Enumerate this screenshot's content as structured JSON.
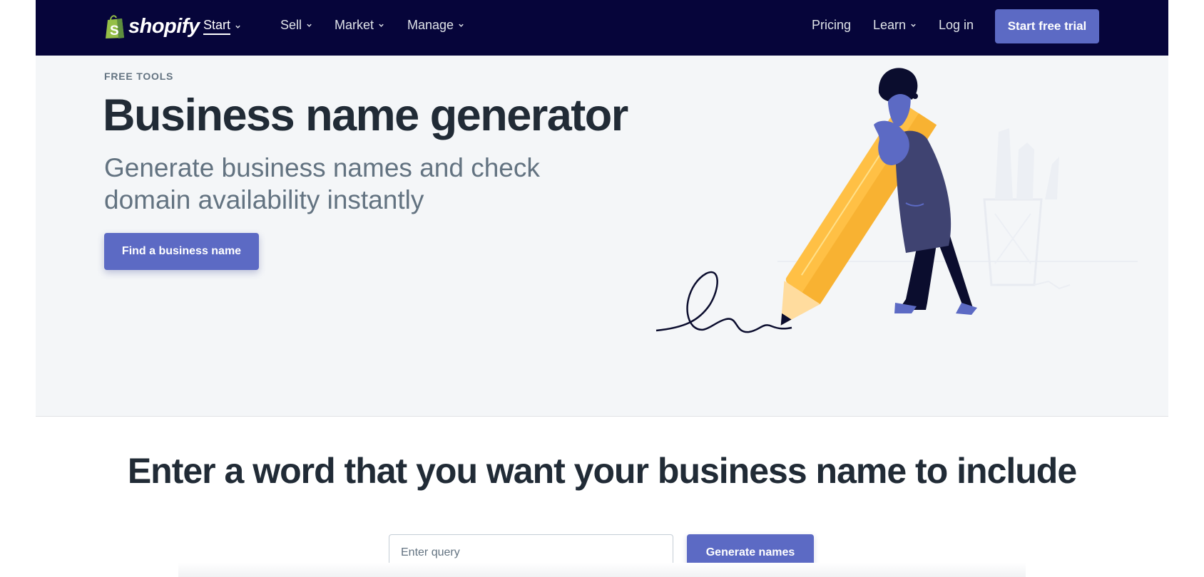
{
  "nav": {
    "brand": "shopify",
    "left_items": [
      {
        "label": "Start",
        "has_dropdown": true,
        "active": true
      },
      {
        "label": "Sell",
        "has_dropdown": true,
        "active": false
      },
      {
        "label": "Market",
        "has_dropdown": true,
        "active": false
      },
      {
        "label": "Manage",
        "has_dropdown": true,
        "active": false
      }
    ],
    "right_items": [
      {
        "label": "Pricing",
        "has_dropdown": false
      },
      {
        "label": "Learn",
        "has_dropdown": true
      },
      {
        "label": "Log in",
        "has_dropdown": false
      }
    ],
    "cta_label": "Start free trial"
  },
  "hero": {
    "eyebrow": "FREE TOOLS",
    "title": "Business name generator",
    "subtitle": "Generate business names and check domain availability instantly",
    "button_label": "Find a business name",
    "illustration": "person-with-giant-pencil-illustration"
  },
  "search": {
    "heading": "Enter a word that you want your business name to include",
    "input_value": "",
    "input_placeholder": "Enter query",
    "button_label": "Generate names"
  },
  "colors": {
    "nav_bg": "#06053a",
    "accent": "#5c6ac4",
    "hero_bg": "#f4f6f8",
    "heading_text": "#212b36",
    "muted_text": "#637381",
    "logo_green": "#95bf47",
    "pencil_yellow": "#ffc045",
    "figure_blue": "#5c6ac4",
    "figure_dress": "#3f4371"
  }
}
